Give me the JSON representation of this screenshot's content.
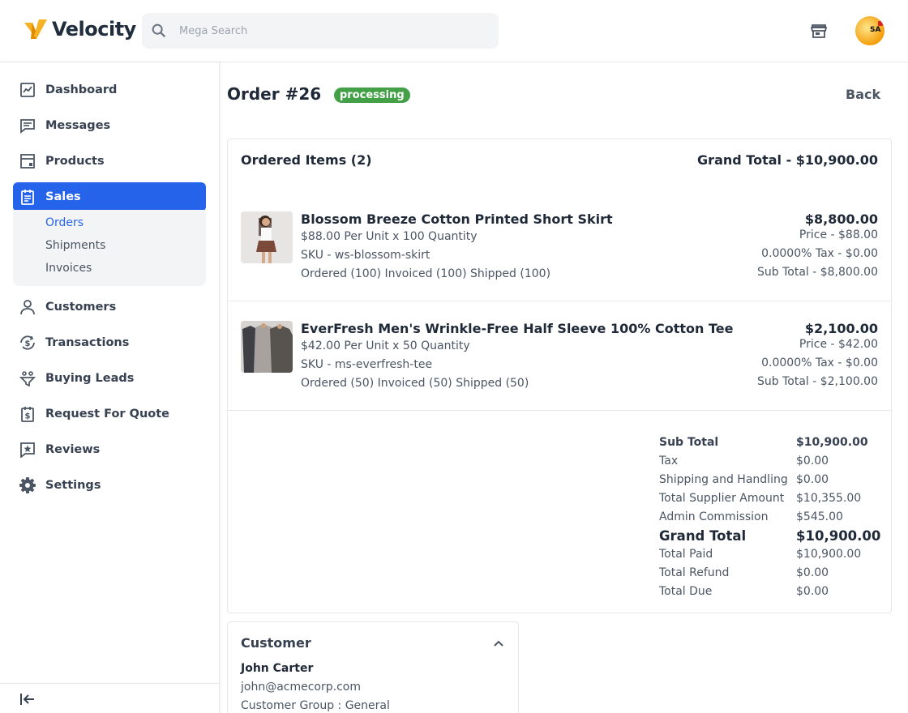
{
  "brand": {
    "name": "Velocity"
  },
  "search": {
    "placeholder": "Mega Search"
  },
  "sidebar": {
    "items": [
      {
        "label": "Dashboard"
      },
      {
        "label": "Messages"
      },
      {
        "label": "Products"
      },
      {
        "label": "Sales"
      },
      {
        "label": "Customers"
      },
      {
        "label": "Transactions"
      },
      {
        "label": "Buying Leads"
      },
      {
        "label": "Request For Quote"
      },
      {
        "label": "Reviews"
      },
      {
        "label": "Settings"
      }
    ],
    "sales_sub": [
      {
        "label": "Orders"
      },
      {
        "label": "Shipments"
      },
      {
        "label": "Invoices"
      }
    ],
    "active": "Sales",
    "active_sub": "Orders"
  },
  "order": {
    "title": "Order #26",
    "status": "processing",
    "back_label": "Back",
    "items_heading": "Ordered Items (2)",
    "grand_total_heading": "Grand Total - $10,900.00",
    "items": [
      {
        "name": "Blossom Breeze Cotton Printed Short Skirt",
        "unit_qty": "$88.00 Per Unit x 100 Quantity",
        "sku": "SKU - ws-blossom-skirt",
        "status_line": "Ordered (100) Invoiced (100) Shipped (100)",
        "total": "$8,800.00",
        "price": "Price - $88.00",
        "tax": "0.0000% Tax - $0.00",
        "subtotal": "Sub Total - $8,800.00"
      },
      {
        "name": "EverFresh Men's Wrinkle-Free Half Sleeve 100% Cotton Tee",
        "unit_qty": "$42.00 Per Unit x 50 Quantity",
        "sku": "SKU - ms-everfresh-tee",
        "status_line": "Ordered (50) Invoiced (50) Shipped (50)",
        "total": "$2,100.00",
        "price": "Price - $42.00",
        "tax": "0.0000% Tax - $0.00",
        "subtotal": "Sub Total - $2,100.00"
      }
    ],
    "summary": [
      {
        "label": "Sub Total",
        "value": "$10,900.00"
      },
      {
        "label": "Tax",
        "value": "$0.00"
      },
      {
        "label": "Shipping and Handling",
        "value": "$0.00"
      },
      {
        "label": "Total Supplier Amount",
        "value": "$10,355.00"
      },
      {
        "label": "Admin Commission",
        "value": "$545.00"
      },
      {
        "label": "Grand Total",
        "value": "$10,900.00"
      },
      {
        "label": "Total Paid",
        "value": "$10,900.00"
      },
      {
        "label": "Total Refund",
        "value": "$0.00"
      },
      {
        "label": "Total Due",
        "value": "$0.00"
      }
    ]
  },
  "customer": {
    "heading": "Customer",
    "name": "John Carter",
    "email": "john@acmecorp.com",
    "group": "Customer Group : General"
  },
  "colors": {
    "accent": "#2563eb",
    "status_badge": "#43a047"
  }
}
